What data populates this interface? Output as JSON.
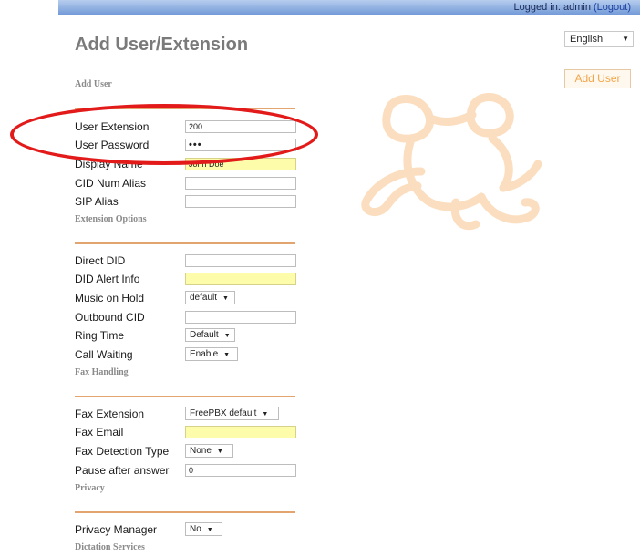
{
  "topbar": {
    "logged_in_prefix": "Logged in: admin",
    "logout_label": "(Logout)"
  },
  "language": {
    "selected": "English"
  },
  "header": {
    "title": "Add User/Extension",
    "add_user_label": "Add User",
    "subtitle": "Add User"
  },
  "add_user": {
    "user_extension": {
      "label": "User Extension",
      "value": "200"
    },
    "user_password": {
      "label": "User Password",
      "value": "•••"
    },
    "display_name": {
      "label": "Display Name",
      "value": "John Doe"
    },
    "cid_num_alias": {
      "label": "CID Num Alias",
      "value": ""
    },
    "sip_alias": {
      "label": "SIP Alias",
      "value": ""
    }
  },
  "extension_options": {
    "heading": "Extension Options",
    "direct_did": {
      "label": "Direct DID",
      "value": ""
    },
    "did_alert_info": {
      "label": "DID Alert Info",
      "value": ""
    },
    "music_on_hold": {
      "label": "Music on Hold",
      "value": "default"
    },
    "outbound_cid": {
      "label": "Outbound CID",
      "value": ""
    },
    "ring_time": {
      "label": "Ring Time",
      "value": "Default"
    },
    "call_waiting": {
      "label": "Call Waiting",
      "value": "Enable"
    }
  },
  "fax_handling": {
    "heading": "Fax Handling",
    "fax_extension": {
      "label": "Fax Extension",
      "value": "FreePBX default"
    },
    "fax_email": {
      "label": "Fax Email",
      "value": ""
    },
    "fax_detection_type": {
      "label": "Fax Detection Type",
      "value": "None"
    },
    "pause_after_answer": {
      "label": "Pause after answer",
      "value": "0"
    }
  },
  "privacy": {
    "heading": "Privacy",
    "privacy_manager": {
      "label": "Privacy Manager",
      "value": "No"
    }
  },
  "dictation": {
    "heading": "Dictation Services"
  },
  "colors": {
    "accent_orange": "#f0a64a",
    "divider": "#e2a570",
    "highlight_oval": "#e31a1a",
    "required_field": "#fdfcab",
    "topbar": "#6f97d6"
  }
}
